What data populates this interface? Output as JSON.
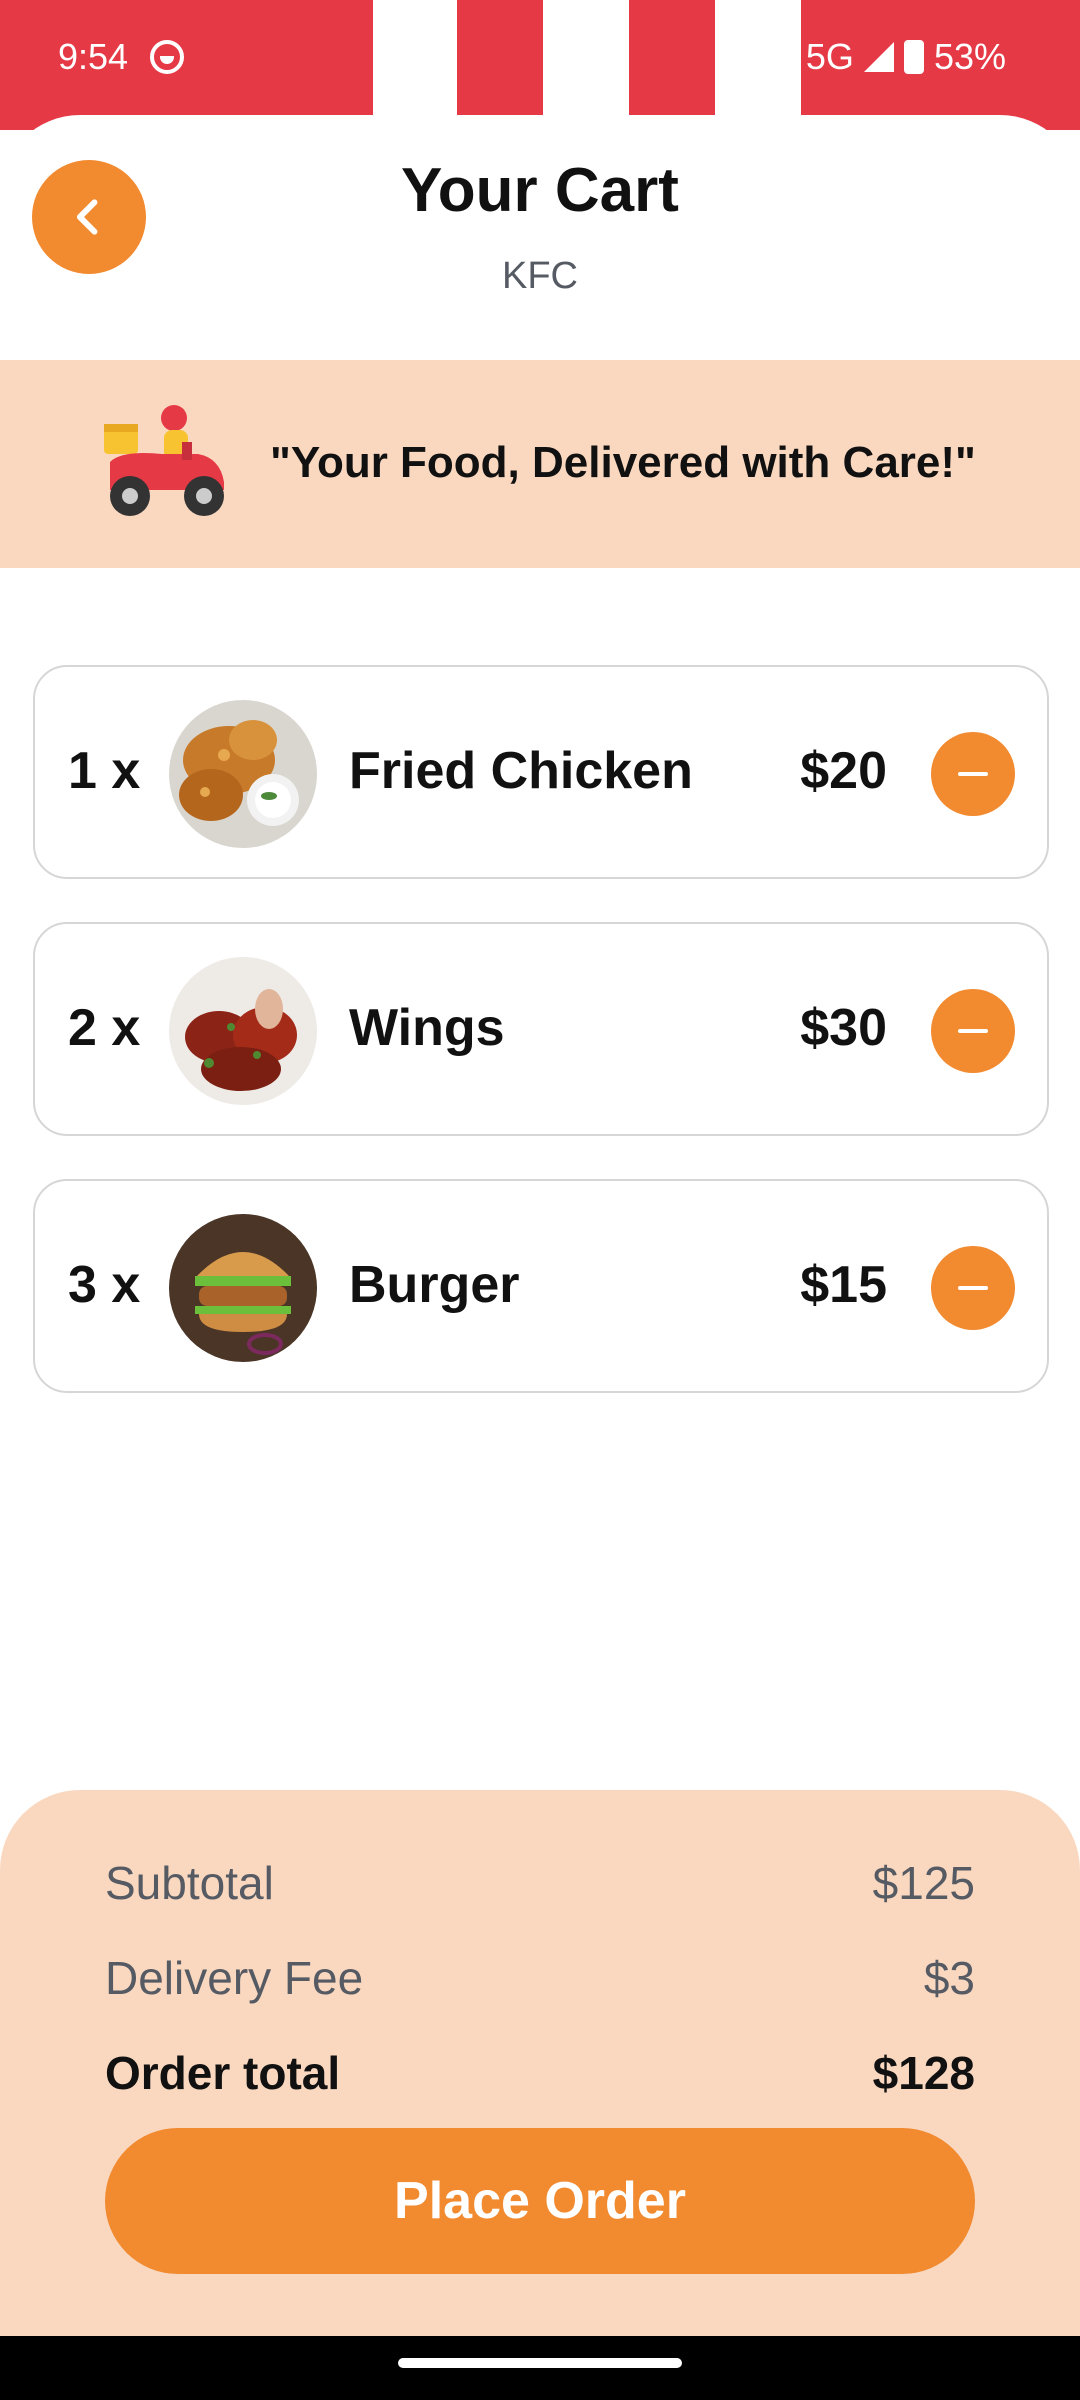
{
  "status_bar": {
    "time": "9:54",
    "network": "5G",
    "battery": "53%"
  },
  "header": {
    "title": "Your Cart",
    "restaurant": "KFC"
  },
  "banner": {
    "text": "\"Your Food, Delivered with Care!\""
  },
  "cart": {
    "items": [
      {
        "qty": "1 x",
        "name": "Fried Chicken",
        "price": "$20",
        "image": "fried-chicken-image"
      },
      {
        "qty": "2 x",
        "name": "Wings",
        "price": "$30",
        "image": "wings-image"
      },
      {
        "qty": "3 x",
        "name": "Burger",
        "price": "$15",
        "image": "burger-image"
      }
    ]
  },
  "summary": {
    "subtotal_label": "Subtotal",
    "subtotal_value": "$125",
    "delivery_label": "Delivery Fee",
    "delivery_value": "$3",
    "total_label": "Order total",
    "total_value": "$128"
  },
  "actions": {
    "place_order": "Place Order"
  },
  "colors": {
    "brand_red": "#e63946",
    "accent_orange": "#f28a30",
    "peach": "#fad8c0"
  }
}
